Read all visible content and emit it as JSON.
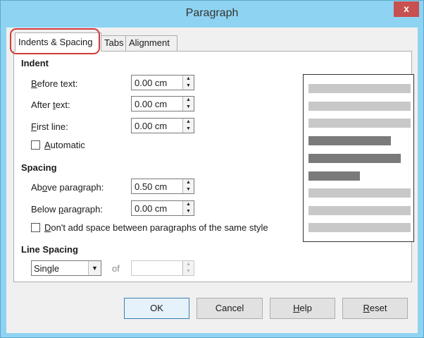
{
  "window": {
    "title": "Paragraph",
    "close_glyph": "x"
  },
  "tabs": [
    {
      "label": "Indents & Spacing",
      "active": true
    },
    {
      "label": "Tabs",
      "active": false
    },
    {
      "label": "Alignment",
      "active": false
    }
  ],
  "indent": {
    "heading": "Indent",
    "before_text": {
      "label_mnemonic": "B",
      "label_rest": "efore text:",
      "value": "0.00 cm"
    },
    "after_text": {
      "label_pre": "After ",
      "label_mnemonic": "t",
      "label_rest": "ext:",
      "value": "0.00 cm"
    },
    "first_line": {
      "label_mnemonic": "F",
      "label_rest": "irst line:",
      "value": "0.00 cm"
    },
    "automatic": {
      "label_mnemonic": "A",
      "label_rest": "utomatic",
      "checked": false
    }
  },
  "spacing": {
    "heading": "Spacing",
    "above": {
      "label_pre": "Ab",
      "label_mnemonic": "o",
      "label_rest": "ve paragraph:",
      "value": "0.50 cm"
    },
    "below": {
      "label_pre": "Below ",
      "label_mnemonic": "p",
      "label_rest": "aragraph:",
      "value": "0.00 cm"
    },
    "no_space": {
      "label_mnemonic": "D",
      "label_rest": "on't add space between paragraphs of the same style",
      "checked": false
    }
  },
  "line_spacing": {
    "heading": "Line Spacing",
    "selected": "Single",
    "of_label": "of",
    "of_value": ""
  },
  "preview": {
    "light_color": "#c8c8c8",
    "dark_color": "#7a7a7a"
  },
  "buttons": {
    "ok": "OK",
    "cancel": "Cancel",
    "help_mnemonic": "H",
    "help_rest": "elp",
    "reset_mnemonic": "R",
    "reset_rest": "eset"
  },
  "spin_up_glyph": "▲",
  "spin_down_glyph": "▼",
  "dropdown_glyph": "▼",
  "annotation": {
    "color": "#d23a3a"
  }
}
